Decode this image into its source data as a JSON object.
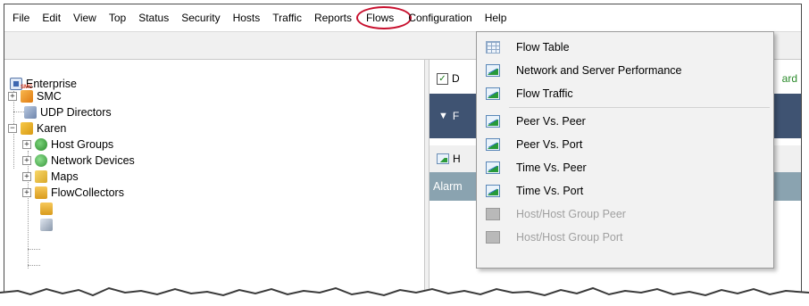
{
  "menubar": {
    "items": [
      "File",
      "Edit",
      "View",
      "Top",
      "Status",
      "Security",
      "Hosts",
      "Traffic",
      "Reports"
    ],
    "flows": "Flows",
    "after": [
      "Configuration",
      "Help"
    ],
    "highlight_color": "#c8102e"
  },
  "tree": {
    "enterprise": "Enterprise",
    "smc_badge": "SMC",
    "smc": "SMC",
    "udp_directors": "UDP Directors",
    "karen": "Karen",
    "host_groups": "Host Groups",
    "network_devices": "Network Devices",
    "maps": "Maps",
    "flow_collectors": "FlowCollectors",
    "expand_symbol": "+",
    "collapse_symbol": "−"
  },
  "right_pane": {
    "check_text": "D",
    "top_right_text": "ard",
    "dark_text": "F",
    "tab_text": "H",
    "alarm_text": "Alarm",
    "dark_color": "#3f5372",
    "teal_color": "#8aa3b0"
  },
  "flows_menu": {
    "group1": [
      {
        "label": "Flow Table",
        "icon": "table-icon"
      },
      {
        "label": "Network and Server Performance",
        "icon": "chart-icon"
      },
      {
        "label": "Flow Traffic",
        "icon": "chart-icon"
      }
    ],
    "group2": [
      {
        "label": "Peer Vs. Peer",
        "icon": "chart-icon"
      },
      {
        "label": "Peer Vs. Port",
        "icon": "chart-icon"
      },
      {
        "label": "Time Vs. Peer",
        "icon": "chart-icon"
      },
      {
        "label": "Time Vs. Port",
        "icon": "chart-icon"
      },
      {
        "label": "Host/Host Group Peer",
        "icon": "grey-chart-icon",
        "disabled": true
      },
      {
        "label": "Host/Host Group Port",
        "icon": "grey-chart-icon",
        "disabled": true
      }
    ]
  }
}
